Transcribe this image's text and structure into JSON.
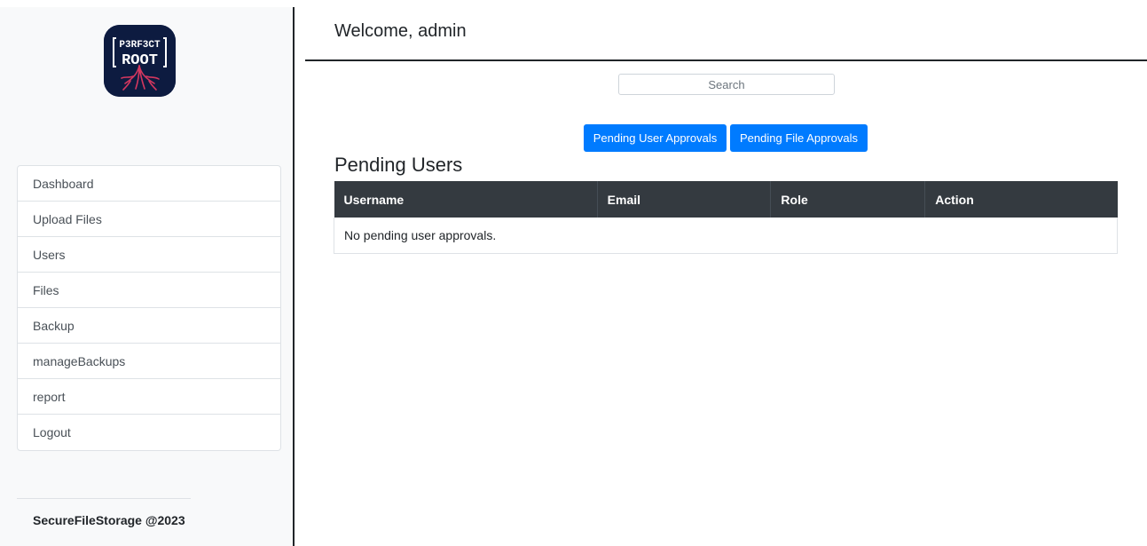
{
  "header": {
    "welcome": "Welcome, admin"
  },
  "logo": {
    "line1": "P3RF3CT",
    "line2": "ROOT"
  },
  "sidebar": {
    "items": [
      {
        "label": "Dashboard"
      },
      {
        "label": "Upload Files"
      },
      {
        "label": "Users"
      },
      {
        "label": "Files"
      },
      {
        "label": "Backup"
      },
      {
        "label": "manageBackups"
      },
      {
        "label": "report"
      },
      {
        "label": "Logout"
      }
    ],
    "footer": "SecureFileStorage @2023"
  },
  "search": {
    "placeholder": "Search",
    "value": ""
  },
  "actions": {
    "pending_users_label": "Pending User Approvals",
    "pending_files_label": "Pending File Approvals"
  },
  "section": {
    "title": "Pending Users"
  },
  "table": {
    "columns": [
      "Username",
      "Email",
      "Role",
      "Action"
    ],
    "empty_message": "No pending user approvals."
  },
  "colors": {
    "primary": "#007bff",
    "table_header": "#343a40",
    "sidebar_bg": "#f8f9fa",
    "logo_bg": "#0d1b40",
    "logo_accent": "#d4375f"
  },
  "icons": {
    "logo": "p3rf3ct-root-logo"
  }
}
